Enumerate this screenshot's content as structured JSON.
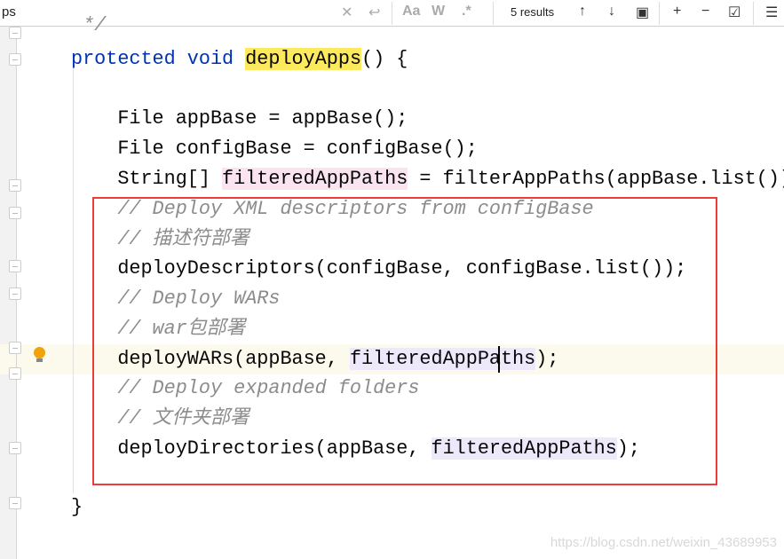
{
  "findbar": {
    "query": "ps",
    "results": "5 results",
    "icons": [
      "close-icon",
      "replace-icon",
      "match-case-icon",
      "words-icon",
      "regex-icon",
      "arrow-up-icon",
      "arrow-down-icon",
      "select-all-icon",
      "add-selection-icon",
      "remove-selection-icon",
      "toggle-selection-icon",
      "filter-icon"
    ],
    "labels": {
      "match_case": "Aa",
      "words": "W",
      "regex": ".*"
    }
  },
  "editor": {
    "lines": [
      [
        {
          "t": " */",
          "c": "cm"
        }
      ],
      [
        {
          "t": "protected void ",
          "c": "kw"
        },
        {
          "t": "deployApps",
          "c": "tx hl-y"
        },
        {
          "t": "() {",
          "c": "tx"
        }
      ],
      [],
      [
        {
          "t": "    File appBase = appBase();",
          "c": "tx"
        }
      ],
      [
        {
          "t": "    File configBase = configBase();",
          "c": "tx"
        }
      ],
      [
        {
          "t": "    String[] ",
          "c": "tx"
        },
        {
          "t": "filteredAppPaths",
          "c": "tx hl-p"
        },
        {
          "t": " = filterAppPaths(appBase.list());",
          "c": "tx"
        }
      ],
      [
        {
          "t": "    // Deploy XML descriptors from configBase",
          "c": "cm"
        }
      ],
      [
        {
          "t": "    // 描述符部署",
          "c": "cm"
        }
      ],
      [
        {
          "t": "    deployDescriptors(configBase, configBase.list());",
          "c": "tx"
        }
      ],
      [
        {
          "t": "    // Deploy WARs",
          "c": "cm"
        }
      ],
      [
        {
          "t": "    // war包部署",
          "c": "cm"
        }
      ],
      [
        {
          "t": "    deployWARs(appBase, ",
          "c": "tx"
        },
        {
          "t": "filteredAppPaths",
          "c": "tx hl-u"
        },
        {
          "t": ");",
          "c": "tx"
        }
      ],
      [
        {
          "t": "    // Deploy expanded folders",
          "c": "cm"
        }
      ],
      [
        {
          "t": "    // 文件夹部署",
          "c": "cm"
        }
      ],
      [
        {
          "t": "    deployDirectories(appBase, ",
          "c": "tx"
        },
        {
          "t": "filteredAppPaths",
          "c": "tx hl-u"
        },
        {
          "t": ");",
          "c": "tx"
        }
      ],
      [],
      [
        {
          "t": "}",
          "c": "tx"
        }
      ]
    ]
  },
  "watermark": "https://blog.csdn.net/weixin_43689953"
}
